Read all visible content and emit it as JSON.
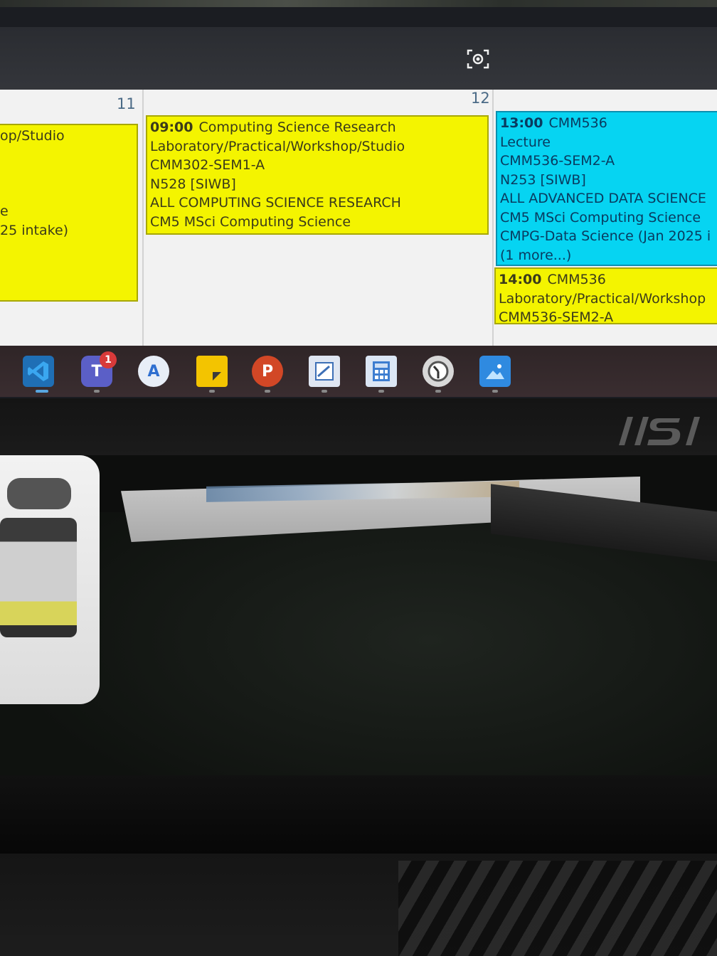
{
  "calendar": {
    "days": [
      {
        "label": "11"
      },
      {
        "label": "12"
      }
    ],
    "events": [
      {
        "lines": [
          "op/Studio",
          "",
          "",
          "",
          "e",
          "25 intake)"
        ]
      },
      {
        "time": "09:00",
        "title": "Computing Science Research",
        "lines": [
          "Laboratory/Practical/Workshop/Studio",
          "CMM302-SEM1-A",
          "N528 [SIWB]",
          "ALL COMPUTING SCIENCE RESEARCH",
          "CM5 MSci Computing Science"
        ]
      },
      {
        "time": "13:00",
        "title": "CMM536",
        "lines": [
          "Lecture",
          "CMM536-SEM2-A",
          "N253 [SIWB]",
          "ALL ADVANCED DATA SCIENCE",
          "CM5 MSci Computing Science",
          "CMPG-Data Science (Jan 2025 i",
          "(1 more...)"
        ]
      },
      {
        "time": "14:00",
        "title": "CMM536",
        "lines": [
          "Laboratory/Practical/Workshop",
          "CMM536-SEM2-A"
        ]
      }
    ]
  },
  "taskbar": {
    "items": [
      {
        "name": "vscode",
        "glyph": ""
      },
      {
        "name": "teams",
        "glyph": "T",
        "badge": "1"
      },
      {
        "name": "app-store",
        "glyph": "A"
      },
      {
        "name": "sticky-notes",
        "glyph": ""
      },
      {
        "name": "powerpoint",
        "glyph": "P"
      },
      {
        "name": "whiteboard",
        "glyph": ""
      },
      {
        "name": "calculator",
        "glyph": ""
      },
      {
        "name": "clock",
        "glyph": ""
      },
      {
        "name": "photos",
        "glyph": ""
      }
    ]
  },
  "colors": {
    "event_yellow": "#f4f400",
    "event_cyan": "#06d4f2",
    "calendar_bg": "#f2f2f2",
    "taskbar_bg": "#3a2d30"
  }
}
